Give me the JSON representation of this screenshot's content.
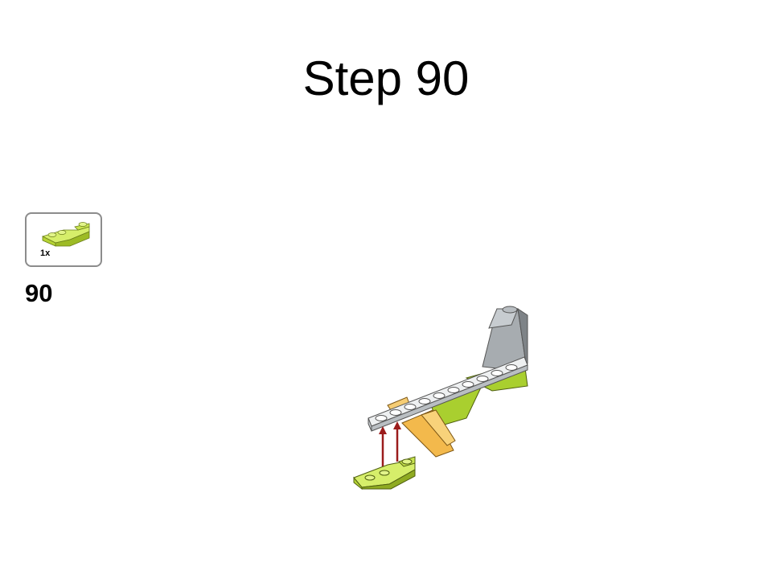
{
  "title": "Step 90",
  "parts_callout": {
    "quantity": "1x",
    "part_icon": "lime-inverted-slope-brick-icon",
    "part_color": "#b5d334"
  },
  "step_number": "90",
  "model": {
    "icon": "lego-model-assembly-icon",
    "arrow_color": "#9b1c1c"
  }
}
